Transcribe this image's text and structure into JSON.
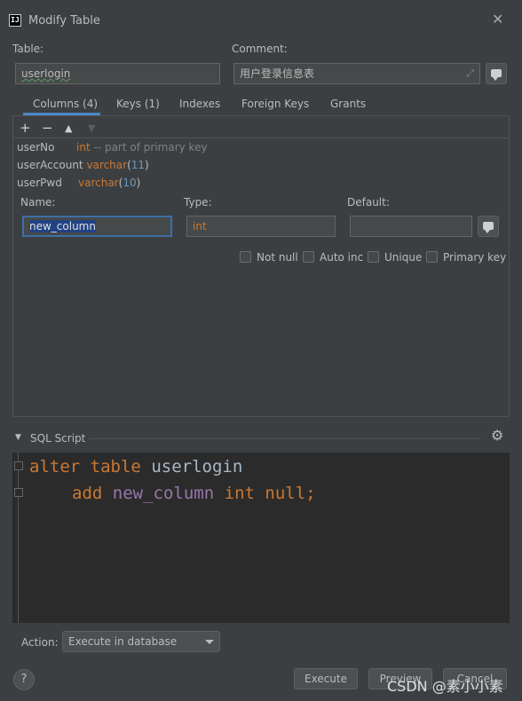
{
  "window": {
    "app_icon_text": "IJ",
    "title": "Modify Table",
    "close_glyph": "✕"
  },
  "form": {
    "table_label": "Table:",
    "table_value": "userlogin",
    "comment_label": "Comment:",
    "comment_value": "用户登录信息表",
    "expand_glyph": "⤢"
  },
  "tabs": [
    "Columns (4)",
    "Keys (1)",
    "Indexes",
    "Foreign Keys",
    "Grants"
  ],
  "toolbar": {
    "add": "+",
    "remove": "−",
    "up": "▲",
    "down": "▼"
  },
  "columns": [
    {
      "name": "userNo",
      "type": "int",
      "extra_type": "",
      "extra": "-- part of primary key"
    },
    {
      "name": "userAccount",
      "type": "varchar",
      "size": "11"
    },
    {
      "name": "userPwd",
      "type": "varchar",
      "size": "10"
    }
  ],
  "editor": {
    "name_label": "Name:",
    "name_value": "new_column",
    "type_label": "Type:",
    "type_value": "int",
    "default_label": "Default:",
    "default_value": "",
    "checkboxes": [
      "Not null",
      "Auto inc",
      "Unique",
      "Primary key"
    ]
  },
  "sql": {
    "header": "SQL Script",
    "collapse_glyph": "▼",
    "gear_glyph": "⚙",
    "line1": {
      "kw1": "alter",
      "kw2": "table",
      "ident": "userlogin"
    },
    "line2": {
      "kw1": "add",
      "ident": "new_column",
      "kw2": "int",
      "kw3": "null;"
    }
  },
  "footer": {
    "action_label": "Action:",
    "action_value": "Execute in database",
    "execute": "Execute",
    "preview": "Preview",
    "cancel": "Cancel",
    "help": "?"
  },
  "watermark": "CSDN @素小小素",
  "colors": {
    "background": "#3c3f41",
    "editor_background": "#2b2b2b",
    "keyword": "#cc7832",
    "number": "#6897bb",
    "accent": "#4a88c7"
  }
}
